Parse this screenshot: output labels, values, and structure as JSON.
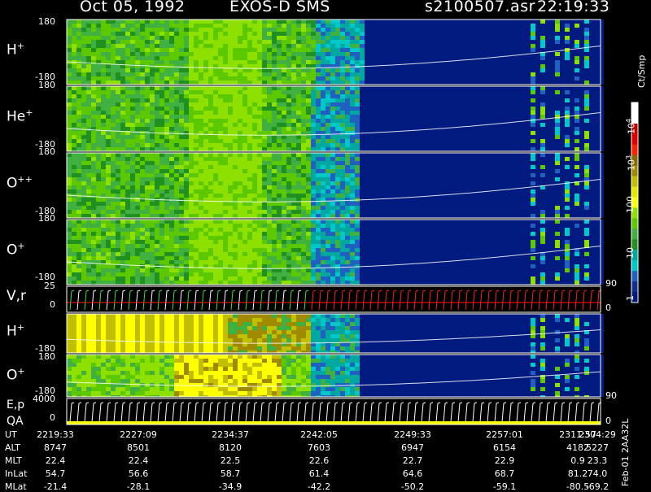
{
  "header": {
    "date": "Oct 05, 1992",
    "instrument": "EXOS-D SMS",
    "file": "s2100507.asr",
    "time": "22:19:33"
  },
  "panels": [
    {
      "name": "H",
      "charge": "+",
      "ytop": "180",
      "ybot": "-180",
      "kind": "spectrogram",
      "profile": "a"
    },
    {
      "name": "He",
      "charge": "+",
      "ytop": "180",
      "ybot": "-180",
      "kind": "spectrogram",
      "profile": "b"
    },
    {
      "name": "O",
      "charge": "++",
      "ytop": "180",
      "ybot": "-180",
      "kind": "spectrogram",
      "profile": "b"
    },
    {
      "name": "O",
      "charge": "+",
      "ytop": "180",
      "ybot": "-180",
      "kind": "spectrogram",
      "profile": "b"
    },
    {
      "name": "V,r",
      "charge": "",
      "ytop": "25",
      "ybot": "0",
      "kind": "vector",
      "right_top": "90",
      "right_bot": "0"
    },
    {
      "name": "H",
      "charge": "+",
      "ytop": "",
      "ybot": "-180",
      "kind": "spectrogram",
      "profile": "c"
    },
    {
      "name": "O",
      "charge": "+",
      "ytop": "180",
      "ybot": "-180",
      "kind": "spectrogram",
      "profile": "d"
    },
    {
      "name": "E,p",
      "charge": "",
      "ytop": "4000",
      "ybot": "0",
      "kind": "vector2",
      "right_top": "90",
      "right_bot": "0",
      "sublabel": "QA"
    }
  ],
  "colorbar": {
    "unit": "Ct/Smp",
    "labels": [
      "10",
      "4",
      "10",
      "3",
      "100",
      "10",
      "1"
    ],
    "colors": [
      "#ffffff",
      "#ffffff",
      "#c00000",
      "#e00000",
      "#ff2000",
      "#8b6b00",
      "#a08a00",
      "#c0c000",
      "#e8e800",
      "#ffff00",
      "#8ee000",
      "#5cc800",
      "#40b040",
      "#209020",
      "#00a8a0",
      "#00c8c8",
      "#2060c0",
      "#103090",
      "#001a80"
    ]
  },
  "footer": {
    "row_labels": [
      "UT",
      "ALT",
      "MLT",
      "InLat",
      "MLat"
    ],
    "columns": [
      [
        "2219:33",
        "8747",
        "22.4",
        "54.7",
        "-21.4"
      ],
      [
        "2227:09",
        "8501",
        "22.4",
        "56.6",
        "-28.1"
      ],
      [
        "2234:37",
        "8120",
        "22.5",
        "58.7",
        "-34.9"
      ],
      [
        "2242:05",
        "7603",
        "22.6",
        "61.4",
        "-42.2"
      ],
      [
        "2249:33",
        "6947",
        "22.7",
        "64.6",
        "-50.2"
      ],
      [
        "2257:01",
        "6154",
        "22.9",
        "68.7",
        "-59.1"
      ],
      [
        "2304:29",
        "5227",
        "23.3",
        "74.0",
        "-69.2"
      ],
      [
        "2311:57",
        "4182",
        "0.9",
        "81.2",
        "-80.5"
      ]
    ],
    "side_stamp": "Feb-01 2AA32L"
  }
}
